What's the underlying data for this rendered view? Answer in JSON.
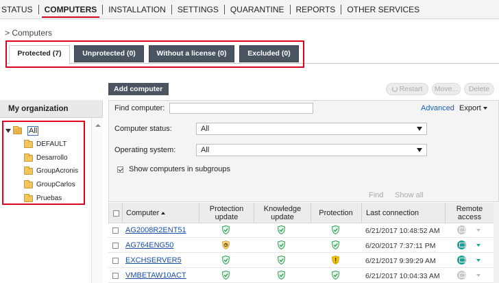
{
  "nav": {
    "items": [
      {
        "label": "STATUS",
        "active": false
      },
      {
        "label": "COMPUTERS",
        "active": true
      },
      {
        "label": "INSTALLATION",
        "active": false
      },
      {
        "label": "SETTINGS",
        "active": false
      },
      {
        "label": "QUARANTINE",
        "active": false
      },
      {
        "label": "REPORTS",
        "active": false
      },
      {
        "label": "OTHER SERVICES",
        "active": false
      }
    ]
  },
  "breadcrumb": "> Computers",
  "tabs": [
    {
      "label": "Protected (7)",
      "active": true
    },
    {
      "label": "Unprotected (0)",
      "active": false
    },
    {
      "label": "Without a license (0)",
      "active": false
    },
    {
      "label": "Excluded (0)",
      "active": false
    }
  ],
  "toolbar": {
    "add_computer": "Add computer",
    "restart": "Restart",
    "move": "Move...",
    "delete": "Delete"
  },
  "organization": {
    "title": "My organization",
    "root": "All",
    "groups": [
      "DEFAULT",
      "Desarrollo",
      "GroupAcronis",
      "GroupCarlos",
      "Pruebas"
    ]
  },
  "filters": {
    "find_label": "Find computer:",
    "find_value": "",
    "advanced": "Advanced",
    "export": "Export",
    "status_label": "Computer status:",
    "status_value": "All",
    "os_label": "Operating system:",
    "os_value": "All",
    "subgroups_label": "Show computers in subgroups",
    "subgroups_checked": true,
    "find_button": "Find",
    "show_all_button": "Show all"
  },
  "table": {
    "headers": {
      "computer": "Computer",
      "protection_update": "Protection update",
      "knowledge_update": "Knowledge update",
      "protection": "Protection",
      "last_connection": "Last connection",
      "remote_access": "Remote access"
    },
    "rows": [
      {
        "computer": "AG2008R2ENT51",
        "protection_update": "ok",
        "knowledge_update": "ok",
        "protection": "ok",
        "last_connection": "6/21/2017 10:48:52 AM",
        "remote": "grey"
      },
      {
        "computer": "AG764ENG50",
        "protection_update": "updating",
        "knowledge_update": "ok",
        "protection": "ok",
        "last_connection": "6/20/2017 7:37:11 PM",
        "remote": "teal"
      },
      {
        "computer": "EXCHSERVER5",
        "protection_update": "ok",
        "knowledge_update": "ok",
        "protection": "warning",
        "last_connection": "6/21/2017 9:39:29 AM",
        "remote": "teal"
      },
      {
        "computer": "VMBETAW10ACT",
        "protection_update": "ok",
        "knowledge_update": "ok",
        "protection": "ok",
        "last_connection": "6/21/2017 10:04:33 AM",
        "remote": "grey"
      }
    ]
  },
  "colors": {
    "accent_red": "#e0001b",
    "dark_button": "#4a5561",
    "link_blue": "#1a4ea6",
    "shield_green": "#2e9e4f",
    "warning_yellow": "#f2c200",
    "remote_teal": "#1aa39a"
  }
}
